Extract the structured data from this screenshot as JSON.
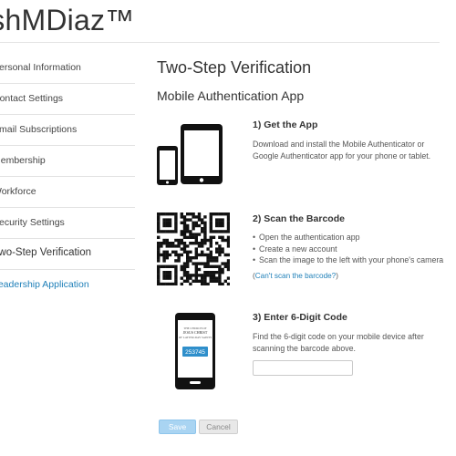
{
  "header": {
    "brand": "ishMDiaz™"
  },
  "sidebar": {
    "items": [
      {
        "label": "Personal Information"
      },
      {
        "label": "Contact Settings"
      },
      {
        "label": "Email Subscriptions"
      },
      {
        "label": "Membership"
      },
      {
        "label": "Workforce"
      },
      {
        "label": "Security Settings"
      },
      {
        "label": "Two-Step Verification"
      },
      {
        "label": "Leadership Application"
      }
    ]
  },
  "main": {
    "title": "Two-Step Verification",
    "section_title": "Mobile Authentication App",
    "steps": [
      {
        "heading": "1) Get the App",
        "text": "Download and install the Mobile Authenticator or Google Authenticator app for your phone or tablet."
      },
      {
        "heading": "2) Scan the Barcode",
        "bullets": [
          "Open the authentication app",
          "Create a new account",
          "Scan the image to the left with your phone's camera"
        ],
        "cant_scan_open": "(",
        "cant_scan_link": "Can't scan the barcode?",
        "cant_scan_close": ")"
      },
      {
        "heading": "3) Enter 6-Digit Code",
        "text": "Find the 6-digit code on your mobile device after scanning the barcode above.",
        "input_value": "",
        "phone_code": "253745",
        "phone_brand_line1": "THE CHURCH OF",
        "phone_brand_line2": "JESUS CHRIST",
        "phone_brand_line3": "OF LATTER-DAY SAINTS"
      }
    ],
    "buttons": {
      "save": "Save",
      "cancel": "Cancel"
    }
  },
  "colors": {
    "link": "#1e7fb8",
    "save_bg": "#a9d4f2",
    "cancel_bg": "#e8e8e8",
    "phone_code_bg": "#2f8fcb"
  }
}
